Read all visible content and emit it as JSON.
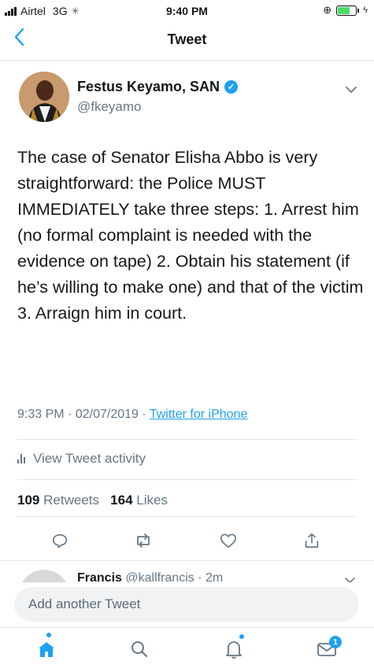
{
  "status_bar": {
    "carrier": "Airtel",
    "network": "3G",
    "time": "9:40 PM",
    "battery_level": 0.75
  },
  "nav": {
    "back_icon": "chevron-left-icon",
    "title": "Tweet"
  },
  "tweet": {
    "author_name": "Festus Keyamo, SAN",
    "handle": "@fkeyamo",
    "verified": true,
    "text": "The case of Senator Elisha Abbo is very straightforward: the Police MUST IMMEDIATELY take three steps: 1. Arrest him (no formal complaint is needed with the evidence on tape) 2. Obtain his statement (if he’s willing to make one) and that of the victim 3. Arraign him in court.",
    "time": "9:33 PM",
    "date": "02/07/2019",
    "separator": "·",
    "source": "Twitter for iPhone",
    "activity_label": "View Tweet activity",
    "retweets_count": "109",
    "retweets_label": "Retweets",
    "likes_count": "164",
    "likes_label": "Likes"
  },
  "reply_preview": {
    "name": "Francis",
    "handle": "@kallfrancis",
    "age": "2m"
  },
  "compose": {
    "placeholder": "Add another Tweet"
  },
  "tabbar": {
    "messages_badge": "1"
  },
  "colors": {
    "accent": "#1da1f2",
    "muted": "#657786",
    "text": "#14171a"
  }
}
